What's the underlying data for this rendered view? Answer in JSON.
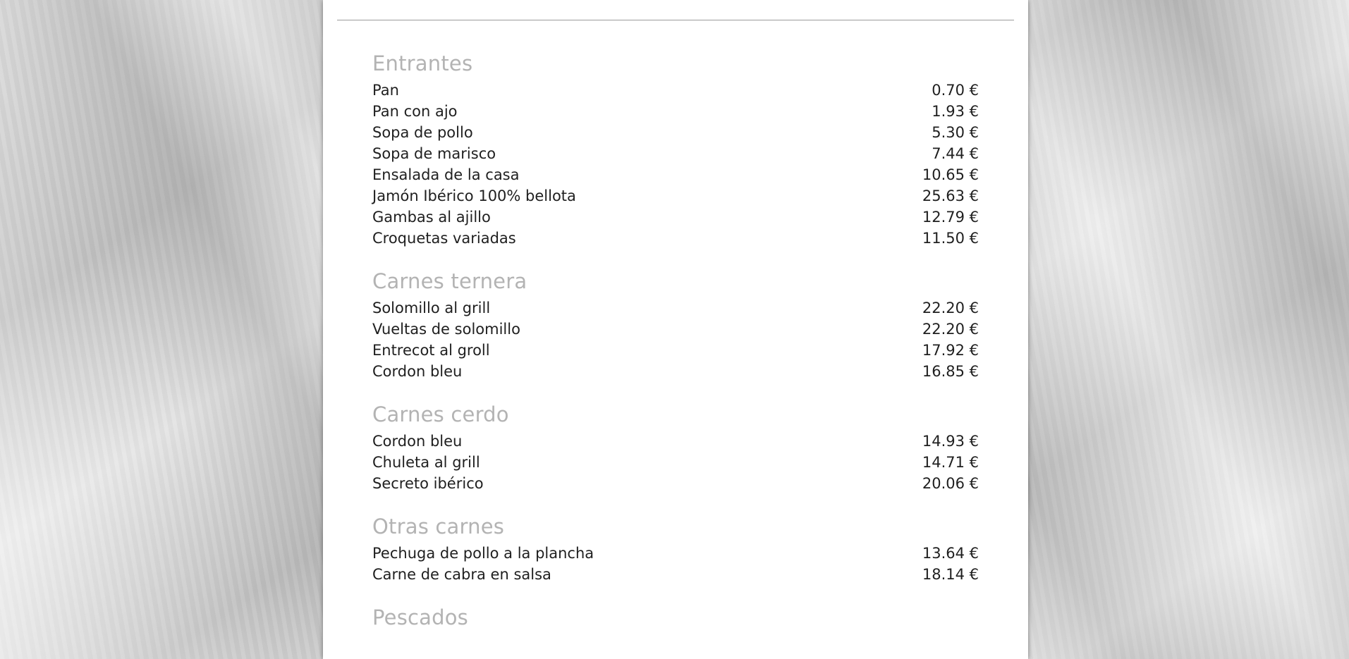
{
  "menu": {
    "sections": [
      {
        "title": "Entrantes",
        "items": [
          {
            "name": "Pan",
            "price": "0.70 €"
          },
          {
            "name": "Pan con ajo",
            "price": "1.93 €"
          },
          {
            "name": "Sopa de pollo",
            "price": "5.30 €"
          },
          {
            "name": "Sopa de marisco",
            "price": "7.44 €"
          },
          {
            "name": "Ensalada de la casa",
            "price": "10.65 €"
          },
          {
            "name": "Jamón Ibérico 100% bellota",
            "price": "25.63 €"
          },
          {
            "name": "Gambas al ajillo",
            "price": "12.79 €"
          },
          {
            "name": "Croquetas variadas",
            "price": "11.50 €"
          }
        ]
      },
      {
        "title": "Carnes ternera",
        "items": [
          {
            "name": "Solomillo al grill",
            "price": "22.20 €"
          },
          {
            "name": "Vueltas de solomillo",
            "price": "22.20 €"
          },
          {
            "name": "Entrecot al groll",
            "price": "17.92 €"
          },
          {
            "name": "Cordon bleu",
            "price": "16.85 €"
          }
        ]
      },
      {
        "title": "Carnes cerdo",
        "items": [
          {
            "name": "Cordon bleu",
            "price": "14.93 €"
          },
          {
            "name": "Chuleta al grill",
            "price": "14.71 €"
          },
          {
            "name": "Secreto ibérico",
            "price": "20.06 €"
          }
        ]
      },
      {
        "title": "Otras carnes",
        "items": [
          {
            "name": "Pechuga de pollo a la plancha",
            "price": "13.64 €"
          },
          {
            "name": "Carne de cabra en salsa",
            "price": "18.14 €"
          }
        ]
      },
      {
        "title": "Pescados",
        "items": []
      }
    ]
  }
}
